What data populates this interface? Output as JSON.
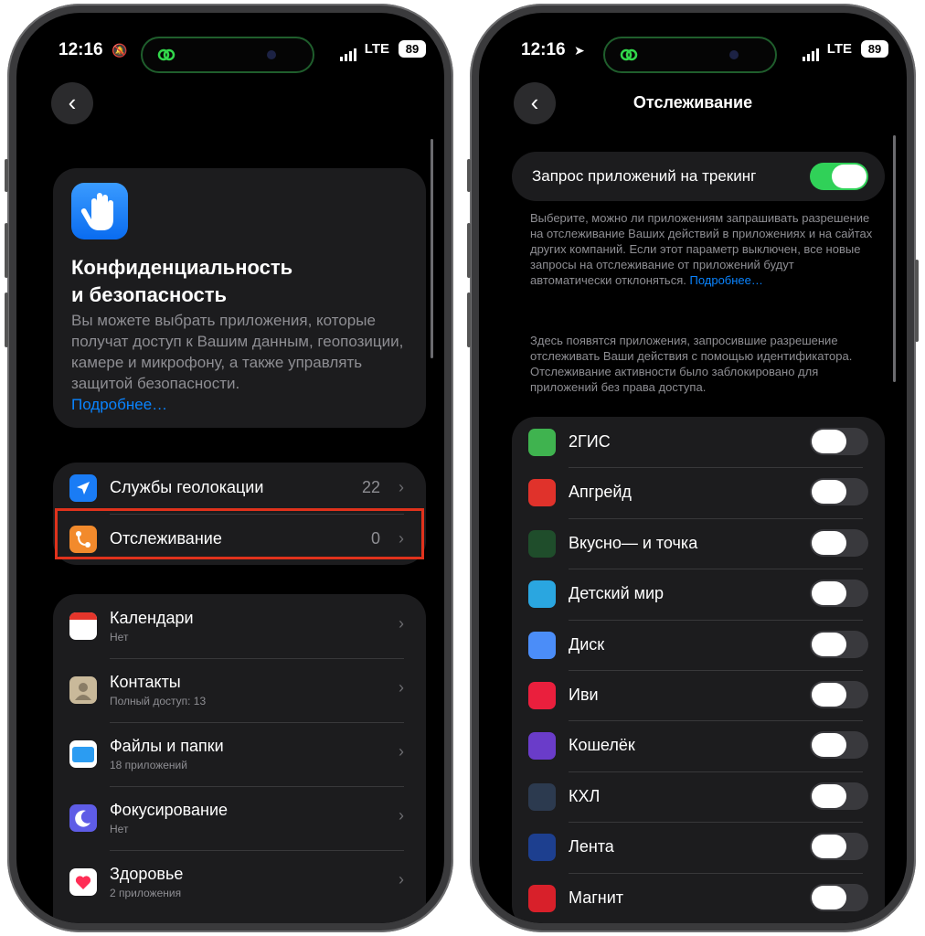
{
  "status_left": {
    "time": "12:16",
    "network": "LTE",
    "battery": "89"
  },
  "status_right": {
    "time": "12:16",
    "network": "LTE",
    "battery": "89"
  },
  "left": {
    "hero": {
      "title_line1": "Конфиденциальность",
      "title_line2": "и безопасность",
      "description": "Вы можете выбрать приложения, которые получат доступ к Вашим данным, геопозиции, камере и микрофону, а также управлять защитой безопасности.",
      "more_link": "Подробнее…"
    },
    "group1": [
      {
        "label": "Службы геолокации",
        "value": "22",
        "icon": "location-arrow-icon",
        "color": "#1a7cf5"
      },
      {
        "label": "Отслеживание",
        "value": "0",
        "icon": "tracking-icon",
        "color": "#f28a2c"
      }
    ],
    "group2": [
      {
        "label": "Календари",
        "sub": "Нет",
        "icon": "calendar-icon"
      },
      {
        "label": "Контакты",
        "sub": "Полный доступ: 13",
        "icon": "contacts-icon"
      },
      {
        "label": "Файлы и папки",
        "sub": "18 приложений",
        "icon": "files-icon"
      },
      {
        "label": "Фокусирование",
        "sub": "Нет",
        "icon": "focus-moon-icon"
      },
      {
        "label": "Здоровье",
        "sub": "2 приложения",
        "icon": "health-heart-icon"
      }
    ]
  },
  "right": {
    "title": "Отслеживание",
    "master_toggle_label": "Запрос приложений на трекинг",
    "master_toggle_on": true,
    "note1": "Выберите, можно ли приложениям запрашивать разрешение на отслеживание Ваших действий в приложениях и на сайтах других компаний. Если этот параметр выключен, все новые запросы на отслеживание от приложений будут автоматически отклоняться.",
    "note1_link": "Подробнее…",
    "note2": "Здесь появятся приложения, запросившие разрешение отслеживать Ваши действия с помощью идентификатора. Отслеживание активности было заблокировано для приложений без права доступа.",
    "apps": [
      {
        "name": "2ГИС",
        "icon": "2gis-icon",
        "color": "#3fb34f"
      },
      {
        "name": "Апгрейд",
        "icon": "upgrade-ring-icon",
        "color": "#e0322b"
      },
      {
        "name": "Вкусно— и точка",
        "icon": "vkusno-icon",
        "color": "#1f4d2b"
      },
      {
        "name": "Детский мир",
        "icon": "detskiy-mir-icon",
        "color": "#2aa6e0"
      },
      {
        "name": "Диск",
        "icon": "disk-cloud-icon",
        "color": "#4b8df8"
      },
      {
        "name": "Иви",
        "icon": "ivi-icon",
        "color": "#ea1f3d"
      },
      {
        "name": "Кошелёк",
        "icon": "wallet-icon",
        "color": "#6a3cc9"
      },
      {
        "name": "КХЛ",
        "icon": "khl-icon",
        "color": "#2c3a4f"
      },
      {
        "name": "Лента",
        "icon": "lenta-icon",
        "color": "#1d3f8f"
      },
      {
        "name": "Магнит",
        "icon": "magnit-icon",
        "color": "#d8202a"
      }
    ]
  }
}
